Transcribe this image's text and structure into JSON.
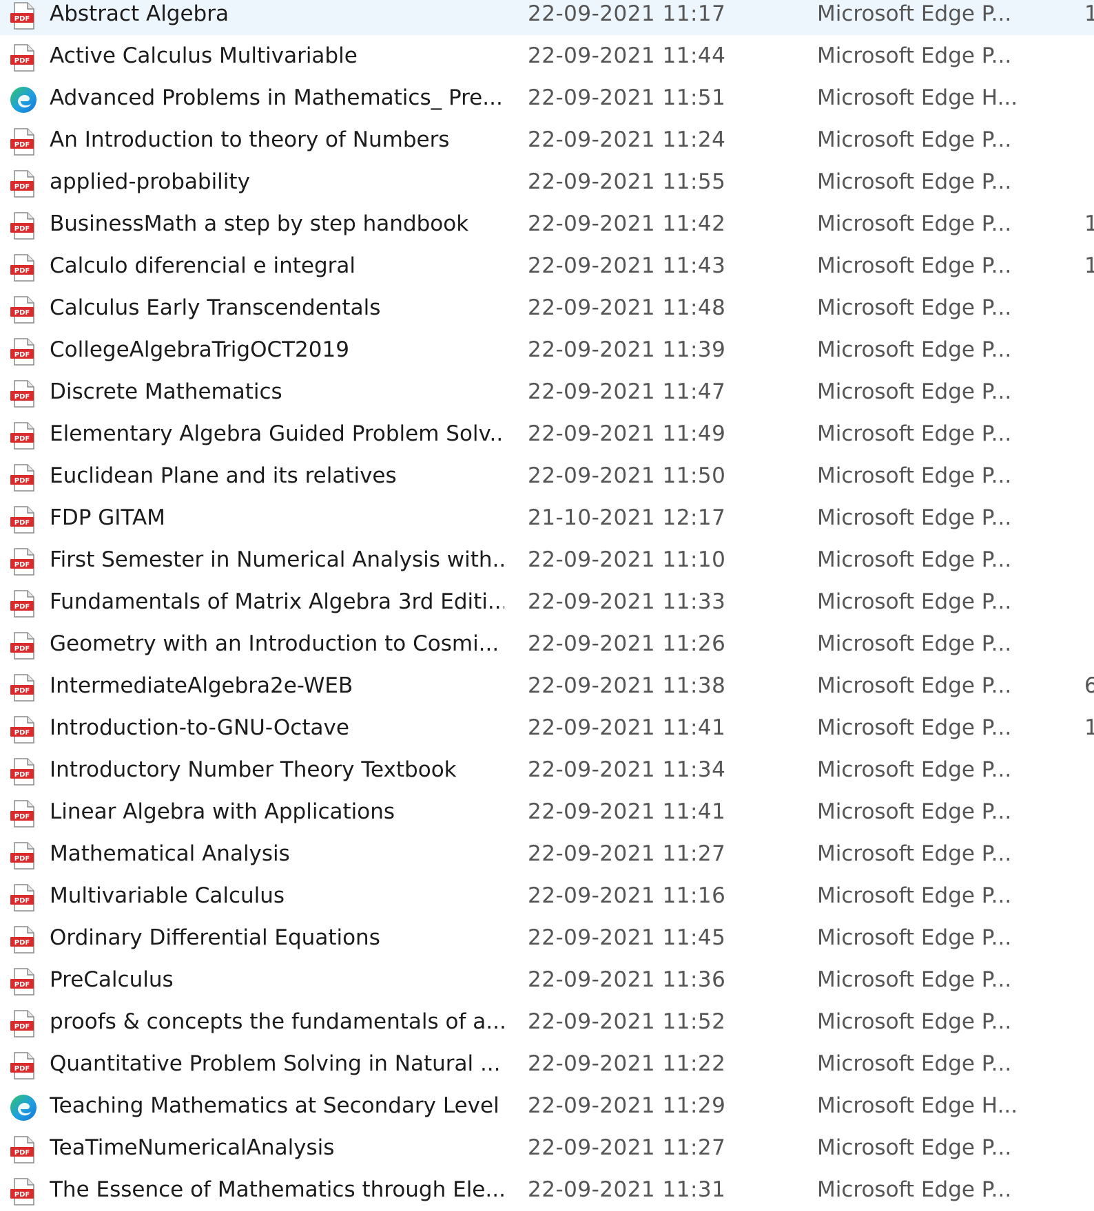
{
  "colors": {
    "pdf_icon": "#d92b2b",
    "edge_blue": "#1473d4",
    "edge_green": "#34c26a",
    "selection": "#eef6fd",
    "meta_text": "#555555"
  },
  "files": [
    {
      "name": "Abstract Algebra",
      "date": "22-09-2021 11:17",
      "type": "Microsoft Edge P...",
      "size": "1",
      "icon": "pdf-icon",
      "selected": true
    },
    {
      "name": "Active Calculus Multivariable",
      "date": "22-09-2021 11:44",
      "type": "Microsoft Edge P...",
      "size": "",
      "icon": "pdf-icon"
    },
    {
      "name": "Advanced Problems in Mathematics_ Pre...",
      "date": "22-09-2021 11:51",
      "type": "Microsoft Edge H...",
      "size": "",
      "icon": "edge-icon"
    },
    {
      "name": "An Introduction to theory of Numbers",
      "date": "22-09-2021 11:24",
      "type": "Microsoft Edge P...",
      "size": "",
      "icon": "pdf-icon"
    },
    {
      "name": "applied-probability",
      "date": "22-09-2021 11:55",
      "type": "Microsoft Edge P...",
      "size": "",
      "icon": "pdf-icon"
    },
    {
      "name": "BusinessMath a step by step handbook",
      "date": "22-09-2021 11:42",
      "type": "Microsoft Edge P...",
      "size": "1",
      "icon": "pdf-icon"
    },
    {
      "name": "Calculo diferencial e integral",
      "date": "22-09-2021 11:43",
      "type": "Microsoft Edge P...",
      "size": "1",
      "icon": "pdf-icon"
    },
    {
      "name": "Calculus Early Transcendentals",
      "date": "22-09-2021 11:48",
      "type": "Microsoft Edge P...",
      "size": "",
      "icon": "pdf-icon"
    },
    {
      "name": "CollegeAlgebraTrigOCT2019",
      "date": "22-09-2021 11:39",
      "type": "Microsoft Edge P...",
      "size": "",
      "icon": "pdf-icon"
    },
    {
      "name": "Discrete Mathematics",
      "date": "22-09-2021 11:47",
      "type": "Microsoft Edge P...",
      "size": "",
      "icon": "pdf-icon"
    },
    {
      "name": "Elementary Algebra Guided Problem Solv...",
      "date": "22-09-2021 11:49",
      "type": "Microsoft Edge P...",
      "size": "",
      "icon": "pdf-icon"
    },
    {
      "name": "Euclidean Plane and its relatives",
      "date": "22-09-2021 11:50",
      "type": "Microsoft Edge P...",
      "size": "",
      "icon": "pdf-icon"
    },
    {
      "name": "FDP GITAM",
      "date": "21-10-2021 12:17",
      "type": "Microsoft Edge P...",
      "size": "",
      "icon": "pdf-icon"
    },
    {
      "name": "First Semester in Numerical Analysis with...",
      "date": "22-09-2021 11:10",
      "type": "Microsoft Edge P...",
      "size": "",
      "icon": "pdf-icon"
    },
    {
      "name": "Fundamentals of Matrix Algebra 3rd Editi...",
      "date": "22-09-2021 11:33",
      "type": "Microsoft Edge P...",
      "size": "",
      "icon": "pdf-icon"
    },
    {
      "name": "Geometry with an Introduction to Cosmi...",
      "date": "22-09-2021 11:26",
      "type": "Microsoft Edge P...",
      "size": "",
      "icon": "pdf-icon"
    },
    {
      "name": "IntermediateAlgebra2e-WEB",
      "date": "22-09-2021 11:38",
      "type": "Microsoft Edge P...",
      "size": "6",
      "icon": "pdf-icon"
    },
    {
      "name": "Introduction-to-GNU-Octave",
      "date": "22-09-2021 11:41",
      "type": "Microsoft Edge P...",
      "size": "1",
      "icon": "pdf-icon"
    },
    {
      "name": "Introductory Number Theory Textbook",
      "date": "22-09-2021 11:34",
      "type": "Microsoft Edge P...",
      "size": "",
      "icon": "pdf-icon"
    },
    {
      "name": "Linear Algebra with Applications",
      "date": "22-09-2021 11:41",
      "type": "Microsoft Edge P...",
      "size": "",
      "icon": "pdf-icon"
    },
    {
      "name": "Mathematical Analysis",
      "date": "22-09-2021 11:27",
      "type": "Microsoft Edge P...",
      "size": "",
      "icon": "pdf-icon"
    },
    {
      "name": "Multivariable Calculus",
      "date": "22-09-2021 11:16",
      "type": "Microsoft Edge P...",
      "size": "",
      "icon": "pdf-icon"
    },
    {
      "name": "Ordinary Differential Equations",
      "date": "22-09-2021 11:45",
      "type": "Microsoft Edge P...",
      "size": "",
      "icon": "pdf-icon"
    },
    {
      "name": "PreCalculus",
      "date": "22-09-2021 11:36",
      "type": "Microsoft Edge P...",
      "size": "",
      "icon": "pdf-icon"
    },
    {
      "name": "proofs & concepts the fundamentals of a...",
      "date": "22-09-2021 11:52",
      "type": "Microsoft Edge P...",
      "size": "",
      "icon": "pdf-icon"
    },
    {
      "name": "Quantitative Problem Solving in Natural ...",
      "date": "22-09-2021 11:22",
      "type": "Microsoft Edge P...",
      "size": "",
      "icon": "pdf-icon"
    },
    {
      "name": "Teaching Mathematics at Secondary Level",
      "date": "22-09-2021 11:29",
      "type": "Microsoft Edge H...",
      "size": "",
      "icon": "edge-icon"
    },
    {
      "name": "TeaTimeNumericalAnalysis",
      "date": "22-09-2021 11:27",
      "type": "Microsoft Edge P...",
      "size": "",
      "icon": "pdf-icon"
    },
    {
      "name": "The Essence of Mathematics through Ele...",
      "date": "22-09-2021 11:31",
      "type": "Microsoft Edge P...",
      "size": "",
      "icon": "pdf-icon"
    }
  ]
}
